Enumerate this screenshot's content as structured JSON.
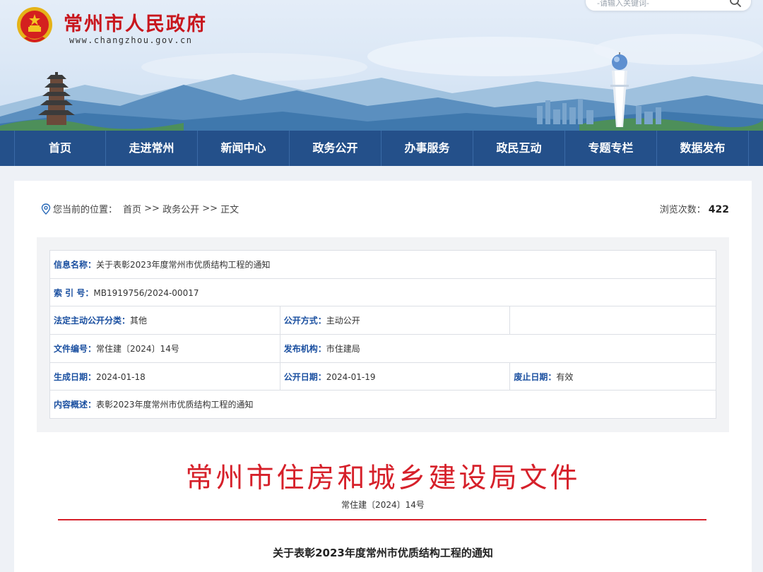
{
  "header": {
    "site_title": "常州市人民政府",
    "site_domain": "www.changzhou.gov.cn",
    "search_placeholder": "-请输入关键词-"
  },
  "nav": [
    {
      "label": "首页"
    },
    {
      "label": "走进常州"
    },
    {
      "label": "新闻中心"
    },
    {
      "label": "政务公开"
    },
    {
      "label": "办事服务"
    },
    {
      "label": "政民互动"
    },
    {
      "label": "专题专栏"
    },
    {
      "label": "数据发布"
    }
  ],
  "breadcrumb": {
    "prefix": "您当前的位置：",
    "home": "首页",
    "sep1": " >> ",
    "section": "政务公开",
    "sep2": " >> ",
    "current": "正文"
  },
  "views": {
    "label": "浏览次数：",
    "count": "422"
  },
  "info": {
    "name_label": "信息名称：",
    "name_value": "关于表彰2023年度常州市优质结构工程的通知",
    "index_label": "索 引 号：",
    "index_value": "MB1919756/2024-00017",
    "category_label": "法定主动公开分类：",
    "category_value": "其他",
    "method_label": "公开方式：",
    "method_value": "主动公开",
    "docno_label": "文件编号：",
    "docno_value": "常住建〔2024〕14号",
    "publisher_label": "发布机构：",
    "publisher_value": "市住建局",
    "created_label": "生成日期：",
    "created_value": "2024-01-18",
    "published_label": "公开日期：",
    "published_value": "2024-01-19",
    "expiry_label": "废止日期：",
    "expiry_value": "有效",
    "summary_label": "内容概述：",
    "summary_value": "表彰2023年度常州市优质结构工程的通知"
  },
  "document": {
    "issuer_title": "常州市住房和城乡建设局文件",
    "doc_number": "常住建〔2024〕14号",
    "notice_title": "关于表彰2023年度常州市优质结构工程的通知"
  },
  "colors": {
    "brand_red": "#c8161d",
    "nav_blue": "#24508a",
    "label_blue": "#1a4fa0",
    "rule_red": "#d6202a"
  }
}
